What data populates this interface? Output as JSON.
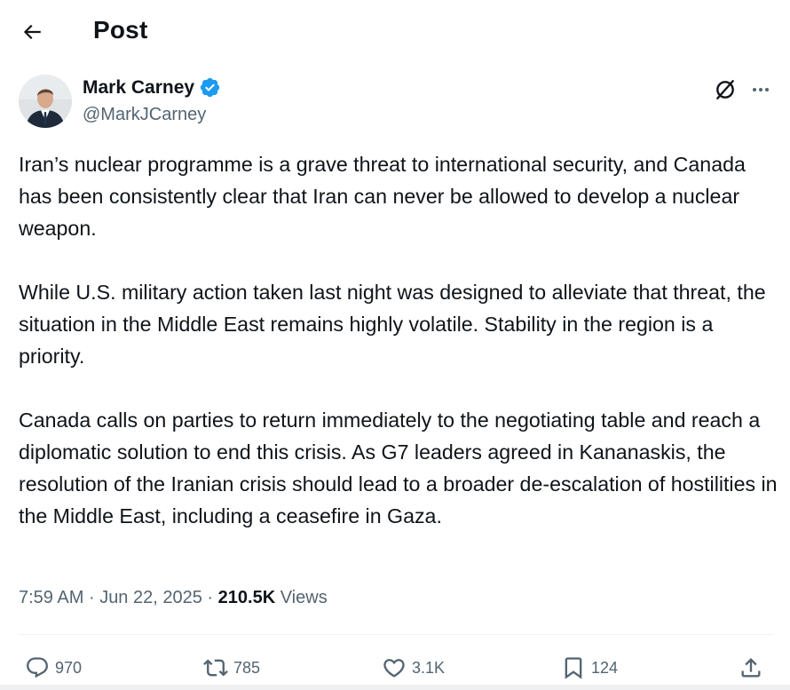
{
  "header": {
    "title": "Post"
  },
  "author": {
    "name": "Mark Carney",
    "handle": "@MarkJCarney"
  },
  "post": {
    "paragraphs": [
      "Iran’s nuclear programme is a grave threat to international security, and Canada has been consistently clear that Iran can never be allowed to develop a nuclear weapon.",
      "While U.S. military action taken last night was designed to alleviate that threat, the situation in the Middle East remains highly volatile. Stability in the region is a priority.",
      "Canada calls on parties to return immediately to the negotiating table and reach a diplomatic solution to end this crisis. As G7 leaders agreed in Kananaskis, the resolution of the Iranian crisis should lead to a broader de-escalation of hostilities in the Middle East, including a ceasefire in Gaza."
    ],
    "time": "7:59 AM",
    "separator": "·",
    "date": "Jun 22, 2025",
    "views_count": "210.5K",
    "views_label": "Views"
  },
  "actions": {
    "replies": "970",
    "reposts": "785",
    "likes": "3.1K",
    "bookmarks": "124"
  },
  "colors": {
    "verified": "#1d9bf0",
    "secondary_text": "#536471",
    "primary_text": "#0f1419"
  },
  "icons": {
    "back": "arrow-left-icon",
    "verified": "verified-badge-icon",
    "grok": "grok-icon",
    "more": "more-horizontal-icon",
    "reply": "reply-icon",
    "repost": "repost-icon",
    "like": "heart-icon",
    "bookmark": "bookmark-icon",
    "share": "share-icon"
  }
}
